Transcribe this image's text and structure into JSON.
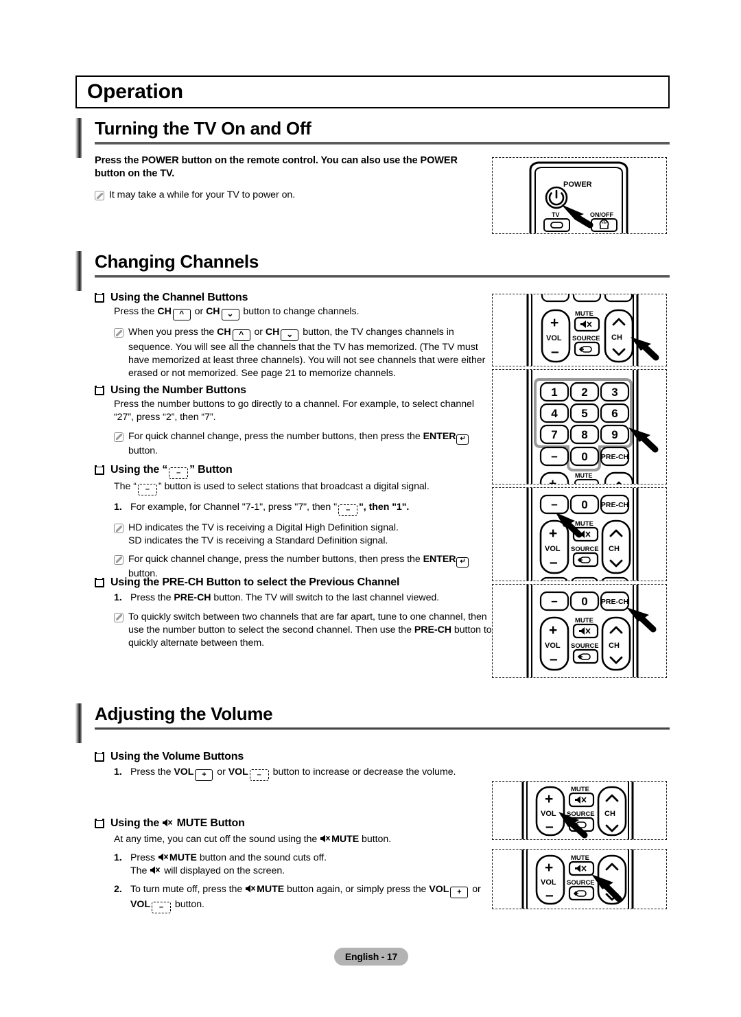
{
  "page": {
    "chapter_title": "Operation",
    "footer_label": "English - 17"
  },
  "sections": [
    {
      "id": "turning-tv-on-off",
      "heading": "Turning the TV On and Off",
      "intro": "Press the POWER button on the remote control. You can also use the POWER button on the TV.",
      "notes": [
        "It may take a while for your TV to power on."
      ]
    },
    {
      "id": "changing-channels",
      "heading": "Changing Channels"
    },
    {
      "id": "adjusting-volume",
      "heading": "Adjusting the Volume"
    }
  ],
  "channel_buttons": {
    "heading": "Using the Channel Buttons",
    "line1_a": "Press the ",
    "line1_ch": "CH",
    "line1_b": " or ",
    "line1_ch2": "CH",
    "line1_c": " button to change channels.",
    "note_a": "When you press the ",
    "note_ch": "CH",
    "note_b": " or ",
    "note_ch2": "CH",
    "note_c": " button, the TV changes channels in sequence. You will see all the channels that the TV has memorized. (The TV must have memorized at least three channels). You will not see channels that were either erased or not memorized. See page 21 to memorize channels."
  },
  "number_buttons": {
    "heading": "Using the Number Buttons",
    "body": "Press the number buttons to go directly to a channel. For example, to select channel “27”, press “2”, then “7”.",
    "note_a": "For quick channel change, press the number buttons, then press the ",
    "note_enter": "ENTER",
    "note_b": " button."
  },
  "dash_button": {
    "heading_pre": "Using the “",
    "heading_post": "” Button",
    "key_label": "–",
    "body_a": "The “",
    "body_b": "” button is used to select stations that broadcast a digital signal.",
    "step1_a": "For example, for Channel \"7-1\", press \"7\", then \"",
    "step1_b": "\", then \"1\".",
    "step1_num": "1.",
    "note1_line1": "HD indicates the TV is receiving a Digital High Definition signal.",
    "note1_line2": "SD indicates the TV is receiving a Standard Definition signal.",
    "note2_a": "For quick channel change, press the number buttons, then press the ",
    "note2_enter": "ENTER",
    "note2_b": " button."
  },
  "prech": {
    "heading": "Using the PRE-CH Button to select the Previous Channel",
    "step1_num": "1.",
    "step1_a": "Press the ",
    "step1_b": "PRE-CH",
    "step1_c": " button. The TV will switch to the last channel viewed.",
    "note_a": "To quickly switch between two channels that are far apart, tune to one channel, then use the number button to select the second channel. Then use the ",
    "note_b": "PRE-CH",
    "note_c": " button to quickly alternate between them."
  },
  "volume_buttons": {
    "heading": "Using the Volume Buttons",
    "step1_num": "1.",
    "step1_a": "Press the ",
    "step1_vol": "VOL",
    "step1_plus": "+",
    "step1_b": " or ",
    "step1_vol2": "VOL",
    "step1_minus": "–",
    "step1_c": " button to increase or decrease the volume."
  },
  "mute_button": {
    "heading_a": "Using the ",
    "heading_b": " MUTE Button",
    "body_a": "At any time, you can cut off the sound using the ",
    "body_mute": "MUTE",
    "body_b": " button.",
    "step1_num": "1.",
    "step1_a": "Press ",
    "step1_mute": "MUTE",
    "step1_b": " button and the sound cuts off.",
    "step1_line2_a": "The ",
    "step1_line2_b": " will displayed on the screen.",
    "step2_num": "2.",
    "step2_a": "To turn mute off, press the ",
    "step2_mute": "MUTE",
    "step2_b": " button again, or simply press the ",
    "step2_vol": "VOL",
    "step2_plus": "+",
    "step2_c": " or ",
    "step2_vol2": "VOL",
    "step2_minus": "–",
    "step2_d": " button."
  },
  "remote_diagrams": {
    "power": {
      "labels": {
        "power": "POWER",
        "tv": "TV",
        "onoff": "ON/OFF"
      }
    },
    "ch": {
      "labels": {
        "vol": "VOL",
        "mute": "MUTE",
        "source": "SOURCE",
        "ch": "CH",
        "plus": "+",
        "minus": "–"
      }
    },
    "keypad": {
      "keys": [
        "1",
        "2",
        "3",
        "4",
        "5",
        "6",
        "7",
        "8",
        "9",
        "–",
        "0",
        "PRE-CH"
      ],
      "labels": {
        "mute": "MUTE",
        "plus": "+"
      }
    },
    "dash": {
      "keys": [
        "–",
        "0",
        "PRE-CH"
      ],
      "labels": {
        "vol": "VOL",
        "mute": "MUTE",
        "source": "SOURCE",
        "ch": "CH",
        "plus": "+",
        "minus": "–"
      }
    },
    "prech": {
      "keys": [
        "–",
        "0",
        "PRE-CH"
      ],
      "labels": {
        "vol": "VOL",
        "mute": "MUTE",
        "source": "SOURCE",
        "ch": "CH",
        "plus": "+",
        "minus": "–"
      }
    },
    "vol": {
      "labels": {
        "vol": "VOL",
        "mute": "MUTE",
        "source": "SOURCE",
        "ch": "CH",
        "plus": "+",
        "minus": "–"
      }
    },
    "mute": {
      "labels": {
        "vol": "VOL",
        "mute": "MUTE",
        "source": "SOURCE",
        "plus": "+",
        "minus": "–"
      }
    }
  }
}
